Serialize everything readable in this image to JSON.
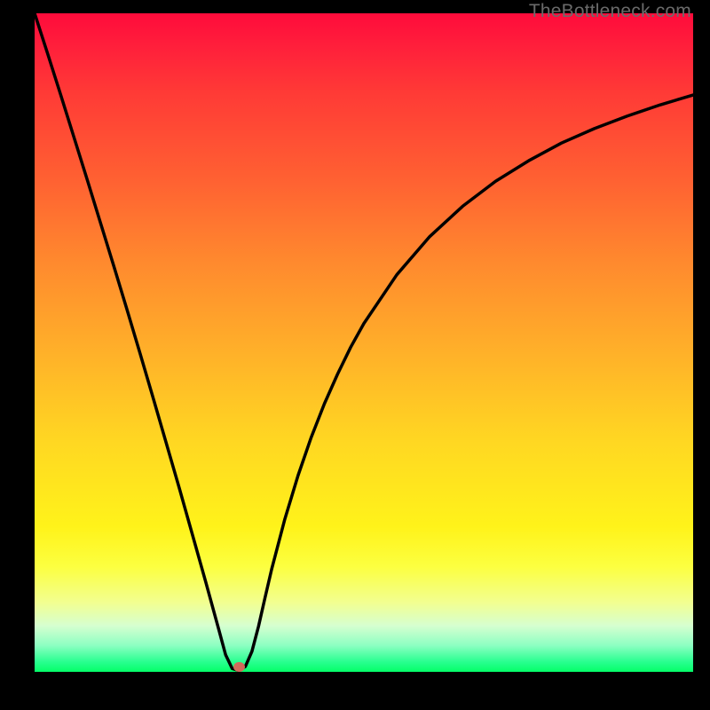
{
  "watermark": "TheBottleneck.com",
  "colors": {
    "background": "#000000",
    "curve_stroke": "#000000",
    "marker": "#d16a5a",
    "gradient_top": "#ff0b3b",
    "gradient_bottom": "#04ff68"
  },
  "chart_data": {
    "type": "line",
    "title": "",
    "xlabel": "",
    "ylabel": "",
    "xlim": [
      0,
      100
    ],
    "ylim": [
      0,
      100
    ],
    "x": [
      0,
      2,
      4,
      6,
      8,
      10,
      12,
      14,
      16,
      18,
      20,
      22,
      24,
      26,
      28,
      29,
      30,
      31,
      32,
      33,
      34,
      35,
      36,
      38,
      40,
      42,
      44,
      46,
      48,
      50,
      55,
      60,
      65,
      70,
      75,
      80,
      85,
      90,
      95,
      100
    ],
    "values": [
      100,
      93.8,
      87.5,
      81.1,
      74.7,
      68.2,
      61.7,
      55.1,
      48.4,
      41.6,
      34.7,
      27.8,
      20.7,
      13.6,
      6.3,
      2.6,
      0.5,
      0.2,
      0.8,
      3.1,
      6.9,
      11.3,
      15.6,
      23.2,
      29.8,
      35.6,
      40.7,
      45.2,
      49.3,
      52.9,
      60.3,
      66.1,
      70.7,
      74.5,
      77.6,
      80.3,
      82.5,
      84.4,
      86.1,
      87.6
    ],
    "marker": {
      "x": 31,
      "y": 0.7
    },
    "gradient_stops": [
      {
        "pos": 0,
        "color": "#ff0b3b"
      },
      {
        "pos": 5,
        "color": "#ff1f3b"
      },
      {
        "pos": 12,
        "color": "#ff3a36"
      },
      {
        "pos": 25,
        "color": "#ff6032"
      },
      {
        "pos": 38,
        "color": "#ff8a2e"
      },
      {
        "pos": 52,
        "color": "#ffb229"
      },
      {
        "pos": 65,
        "color": "#ffd722"
      },
      {
        "pos": 78,
        "color": "#fff31a"
      },
      {
        "pos": 84,
        "color": "#fcff40"
      },
      {
        "pos": 89.5,
        "color": "#f2ff91"
      },
      {
        "pos": 93,
        "color": "#d6ffd0"
      },
      {
        "pos": 96,
        "color": "#8cffc2"
      },
      {
        "pos": 98.5,
        "color": "#28ff8f"
      },
      {
        "pos": 100,
        "color": "#04ff68"
      }
    ]
  }
}
